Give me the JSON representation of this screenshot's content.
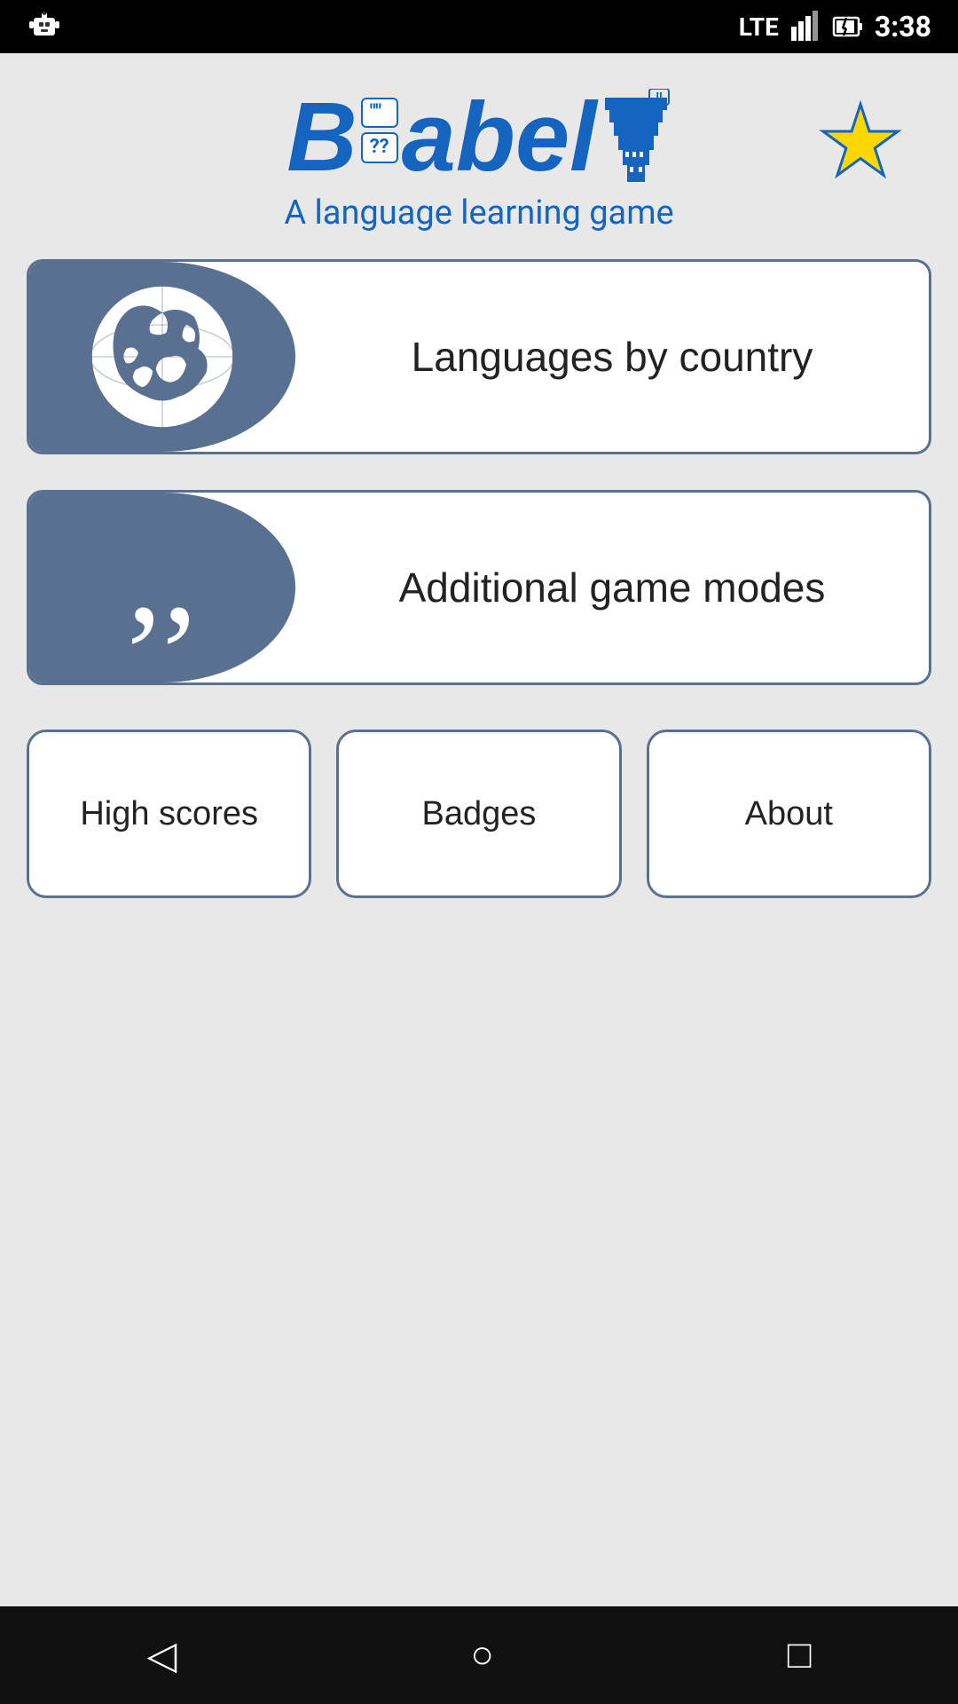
{
  "statusBar": {
    "time": "3:38",
    "signal": "LTE",
    "robotIcon": "🤖"
  },
  "header": {
    "appName": "Babel",
    "subtitle": "A language learning game",
    "starLabel": "star"
  },
  "menuButtons": [
    {
      "id": "languages-by-country",
      "label": "Languages by country",
      "icon": "globe"
    },
    {
      "id": "additional-game-modes",
      "label": "Additional game modes",
      "icon": "quotes"
    }
  ],
  "bottomButtons": [
    {
      "id": "high-scores",
      "label": "High scores"
    },
    {
      "id": "badges",
      "label": "Badges"
    },
    {
      "id": "about",
      "label": "About"
    }
  ],
  "navBar": {
    "back": "◁",
    "home": "○",
    "recents": "□"
  }
}
